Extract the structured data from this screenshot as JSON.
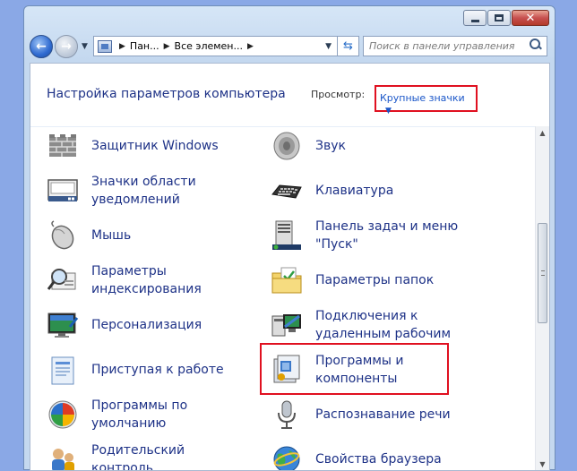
{
  "window": {
    "minimize_glyph": "−",
    "close_glyph": "✕"
  },
  "nav": {
    "back_glyph": "←",
    "forward_glyph": "→",
    "dropdown_glyph": "▼"
  },
  "address": {
    "segments": [
      "Пан...",
      "Все элемен..."
    ],
    "separator": "▶",
    "dropdown_glyph": "▼",
    "refresh_glyph": "⇆"
  },
  "search": {
    "placeholder": "Поиск в панели управления"
  },
  "header": {
    "title": "Настройка параметров компьютера",
    "view_label": "Просмотр:",
    "view_value": "Крупные значки",
    "view_arrow": "▼"
  },
  "items_left": [
    {
      "label": "Защитник Windows",
      "icon": "wall-icon"
    },
    {
      "label": "Значки области уведомлений",
      "icon": "notification-icons-icon"
    },
    {
      "label": "Мышь",
      "icon": "mouse-icon"
    },
    {
      "label": "Параметры индексирования",
      "icon": "indexing-icon"
    },
    {
      "label": "Персонализация",
      "icon": "personalization-icon"
    },
    {
      "label": "Приступая к работе",
      "icon": "getting-started-icon"
    },
    {
      "label": "Программы по умолчанию",
      "icon": "default-programs-icon"
    },
    {
      "label": "Родительский контроль",
      "icon": "parental-control-icon"
    }
  ],
  "items_right": [
    {
      "label": "Звук",
      "icon": "speaker-icon"
    },
    {
      "label": "Клавиатура",
      "icon": "keyboard-icon"
    },
    {
      "label": "Панель задач и меню \"Пуск\"",
      "icon": "taskbar-icon"
    },
    {
      "label": "Параметры папок",
      "icon": "folder-options-icon"
    },
    {
      "label": "Подключения к удаленным рабочим",
      "icon": "remote-connections-icon"
    },
    {
      "label": "Программы и компоненты",
      "icon": "programs-features-icon"
    },
    {
      "label": "Распознавание речи",
      "icon": "microphone-icon"
    },
    {
      "label": "Свойства браузера",
      "icon": "browser-globe-icon"
    }
  ],
  "scrollbar": {
    "up_glyph": "▲",
    "down_glyph": "▼"
  },
  "colors": {
    "link_blue": "#1e3287",
    "highlight_red": "#e01020",
    "desktop_blue": "#8aa8e6"
  }
}
